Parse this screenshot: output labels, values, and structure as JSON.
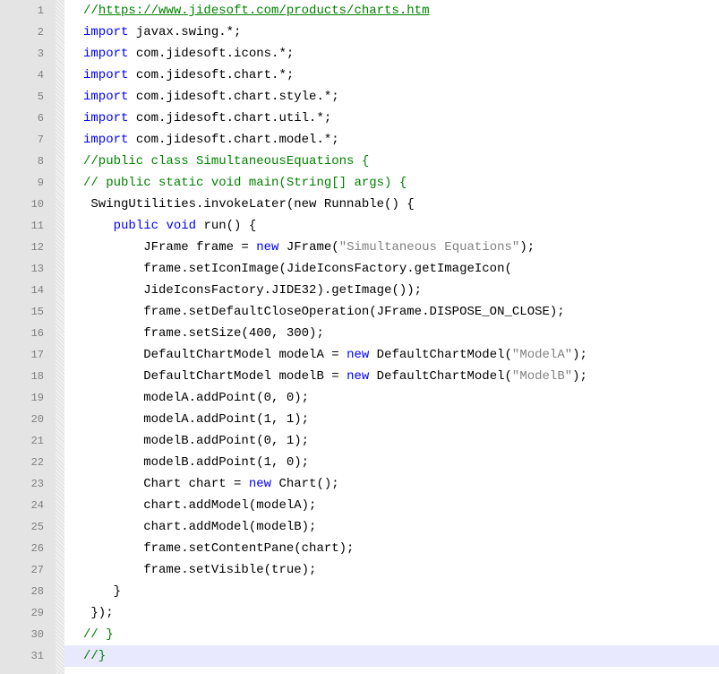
{
  "colors": {
    "comment": "#008000",
    "keyword": "#0000ff",
    "string": "#808080",
    "plain": "#000000",
    "gutter": "#e4e4e4",
    "line_number": "#808080",
    "current_line": "#e8e8ff"
  },
  "current_line": 31,
  "lines": [
    {
      "n": "1",
      "indent": "",
      "tokens": [
        [
          "comment",
          "//"
        ],
        [
          "comment_ul",
          "https://www.jidesoft.com/products/charts.htm"
        ]
      ]
    },
    {
      "n": "2",
      "indent": "",
      "tokens": [
        [
          "keyword",
          "import"
        ],
        [
          "plain",
          " javax.swing.*;"
        ]
      ]
    },
    {
      "n": "3",
      "indent": "",
      "tokens": [
        [
          "keyword",
          "import"
        ],
        [
          "plain",
          " com.jidesoft.icons.*;"
        ]
      ]
    },
    {
      "n": "4",
      "indent": "",
      "tokens": [
        [
          "keyword",
          "import"
        ],
        [
          "plain",
          " com.jidesoft.chart.*;"
        ]
      ]
    },
    {
      "n": "5",
      "indent": "",
      "tokens": [
        [
          "keyword",
          "import"
        ],
        [
          "plain",
          " com.jidesoft.chart.style.*;"
        ]
      ]
    },
    {
      "n": "6",
      "indent": "",
      "tokens": [
        [
          "keyword",
          "import"
        ],
        [
          "plain",
          " com.jidesoft.chart.util.*;"
        ]
      ]
    },
    {
      "n": "7",
      "indent": "",
      "tokens": [
        [
          "keyword",
          "import"
        ],
        [
          "plain",
          " com.jidesoft.chart.model.*;"
        ]
      ]
    },
    {
      "n": "8",
      "indent": "",
      "tokens": [
        [
          "comment",
          "//public class SimultaneousEquations {"
        ]
      ]
    },
    {
      "n": "9",
      "indent": "",
      "tokens": [
        [
          "comment",
          "// public static void main(String[] args) {"
        ]
      ]
    },
    {
      "n": "10",
      "indent": " ",
      "tokens": [
        [
          "plain",
          "SwingUtilities.invokeLater(new Runnable() {"
        ]
      ]
    },
    {
      "n": "11",
      "indent": "    ",
      "tokens": [
        [
          "keyword",
          "public"
        ],
        [
          "plain",
          " "
        ],
        [
          "keyword",
          "void"
        ],
        [
          "plain",
          " run() {"
        ]
      ]
    },
    {
      "n": "12",
      "indent": "        ",
      "tokens": [
        [
          "plain",
          "JFrame frame = "
        ],
        [
          "keyword",
          "new"
        ],
        [
          "plain",
          " JFrame("
        ],
        [
          "string",
          "\"Simultaneous Equations\""
        ],
        [
          "plain",
          ");"
        ]
      ]
    },
    {
      "n": "13",
      "indent": "        ",
      "tokens": [
        [
          "plain",
          "frame.setIconImage(JideIconsFactory.getImageIcon("
        ]
      ]
    },
    {
      "n": "14",
      "indent": "        ",
      "tokens": [
        [
          "plain",
          "JideIconsFactory.JIDE32).getImage());"
        ]
      ]
    },
    {
      "n": "15",
      "indent": "        ",
      "tokens": [
        [
          "plain",
          "frame.setDefaultCloseOperation(JFrame.DISPOSE_ON_CLOSE);"
        ]
      ]
    },
    {
      "n": "16",
      "indent": "        ",
      "tokens": [
        [
          "plain",
          "frame.setSize(400, 300);"
        ]
      ]
    },
    {
      "n": "17",
      "indent": "        ",
      "tokens": [
        [
          "plain",
          "DefaultChartModel modelA = "
        ],
        [
          "keyword",
          "new"
        ],
        [
          "plain",
          " DefaultChartModel("
        ],
        [
          "string",
          "\"ModelA\""
        ],
        [
          "plain",
          ");"
        ]
      ]
    },
    {
      "n": "18",
      "indent": "        ",
      "tokens": [
        [
          "plain",
          "DefaultChartModel modelB = "
        ],
        [
          "keyword",
          "new"
        ],
        [
          "plain",
          " DefaultChartModel("
        ],
        [
          "string",
          "\"ModelB\""
        ],
        [
          "plain",
          ");"
        ]
      ]
    },
    {
      "n": "19",
      "indent": "        ",
      "tokens": [
        [
          "plain",
          "modelA.addPoint(0, 0);"
        ]
      ]
    },
    {
      "n": "20",
      "indent": "        ",
      "tokens": [
        [
          "plain",
          "modelA.addPoint(1, 1);"
        ]
      ]
    },
    {
      "n": "21",
      "indent": "        ",
      "tokens": [
        [
          "plain",
          "modelB.addPoint(0, 1);"
        ]
      ]
    },
    {
      "n": "22",
      "indent": "        ",
      "tokens": [
        [
          "plain",
          "modelB.addPoint(1, 0);"
        ]
      ]
    },
    {
      "n": "23",
      "indent": "        ",
      "tokens": [
        [
          "plain",
          "Chart chart = "
        ],
        [
          "keyword",
          "new"
        ],
        [
          "plain",
          " Chart();"
        ]
      ]
    },
    {
      "n": "24",
      "indent": "        ",
      "tokens": [
        [
          "plain",
          "chart.addModel(modelA);"
        ]
      ]
    },
    {
      "n": "25",
      "indent": "        ",
      "tokens": [
        [
          "plain",
          "chart.addModel(modelB);"
        ]
      ]
    },
    {
      "n": "26",
      "indent": "        ",
      "tokens": [
        [
          "plain",
          "frame.setContentPane(chart);"
        ]
      ]
    },
    {
      "n": "27",
      "indent": "        ",
      "tokens": [
        [
          "plain",
          "frame.setVisible(true);"
        ]
      ]
    },
    {
      "n": "28",
      "indent": "    ",
      "tokens": [
        [
          "plain",
          "}"
        ]
      ]
    },
    {
      "n": "29",
      "indent": " ",
      "tokens": [
        [
          "plain",
          "});"
        ]
      ]
    },
    {
      "n": "30",
      "indent": "",
      "tokens": [
        [
          "comment",
          "// }"
        ]
      ]
    },
    {
      "n": "31",
      "indent": "",
      "tokens": [
        [
          "comment",
          "//}"
        ]
      ]
    }
  ]
}
